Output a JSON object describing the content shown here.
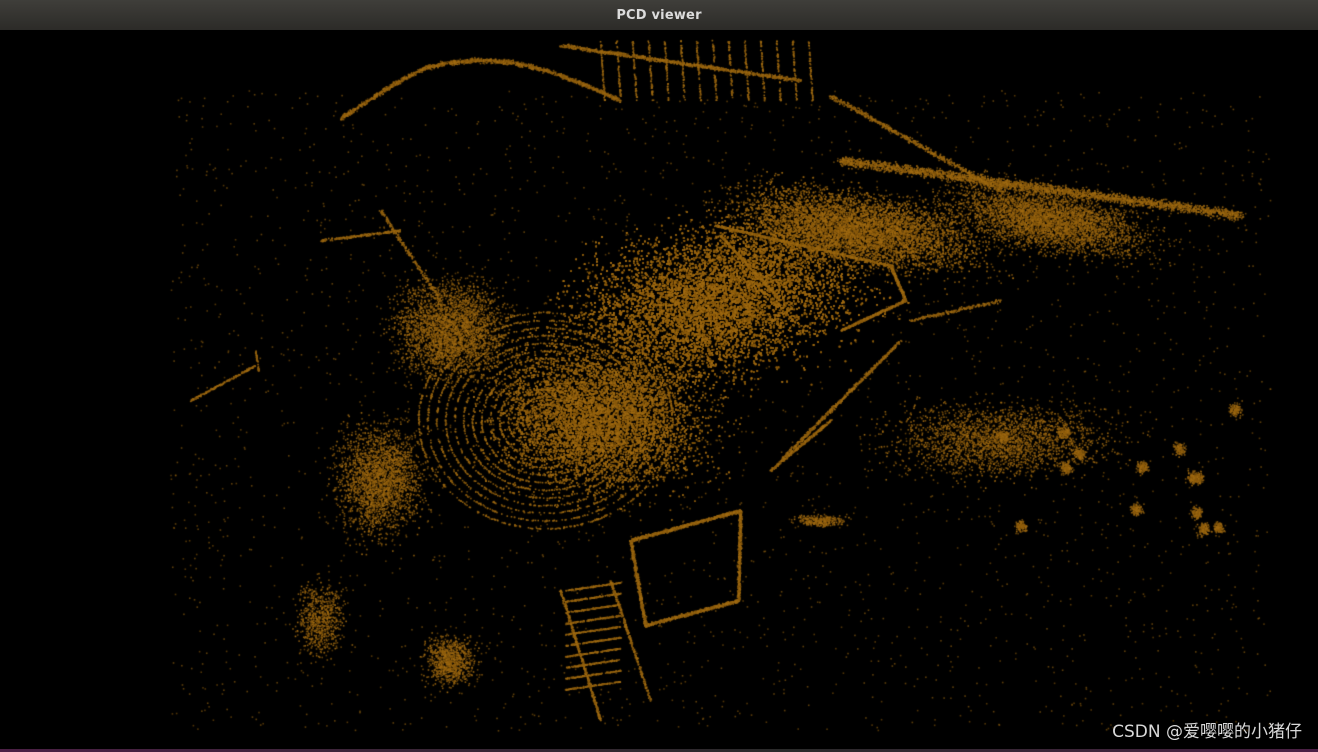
{
  "window": {
    "title": "PCD viewer"
  },
  "viewer": {
    "background_color": "#000000",
    "point_color": "#8a5a0c",
    "point_color_bright": "#a06a12"
  },
  "watermark": {
    "text": "CSDN @爱嘤嘤的小猪仔"
  }
}
